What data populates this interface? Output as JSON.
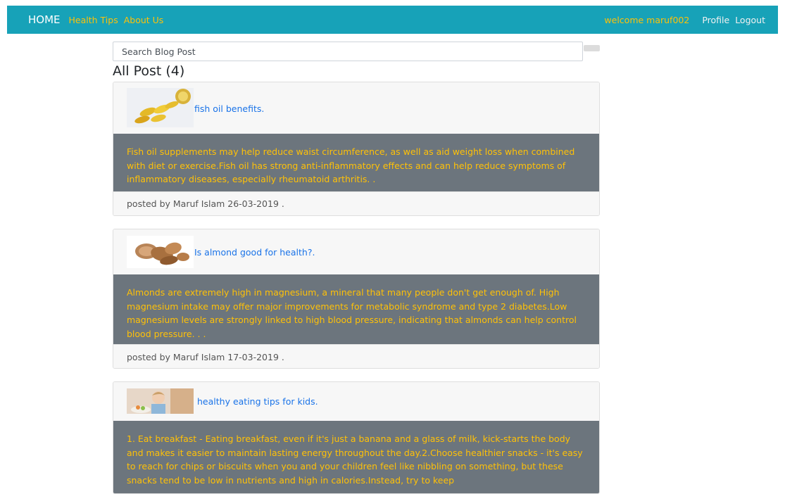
{
  "nav": {
    "brand": "HOME",
    "links": [
      "Health Tips",
      "About Us"
    ],
    "welcome": "welcome maruf002",
    "profile": "Profile",
    "logout": "Logout"
  },
  "search": {
    "placeholder": "Search Blog Post"
  },
  "heading": "All Post (4)",
  "posts": [
    {
      "title": "fish oil benefits.",
      "body": "Fish oil supplements may help reduce waist circumference, as well as aid weight loss when combined with diet or exercise.Fish oil has strong anti-inflammatory effects and can help reduce symptoms of inflammatory diseases, especially rheumatoid arthritis. .",
      "footer": "posted by Maruf Islam 26-03-2019 ."
    },
    {
      "title": "Is almond good for health?.",
      "body": "Almonds are extremely high in magnesium, a mineral that many people don't get enough of. High magnesium intake may offer major improvements for metabolic syndrome and type 2 diabetes.Low magnesium levels are strongly linked to high blood pressure, indicating that almonds can help control blood pressure. . .",
      "footer": "posted by Maruf Islam 17-03-2019 ."
    },
    {
      "title": "healthy eating tips for kids.",
      "body": "1. Eat breakfast - Eating breakfast, even if it's just a banana and a glass of milk, kick-starts the body and makes it easier to maintain lasting energy throughout the day.2.Choose healthier snacks - it's easy to reach for chips or biscuits when you and your children feel like nibbling on something, but these snacks tend to be low in nutrients and high in calories.Instead, try to keep"
    }
  ]
}
